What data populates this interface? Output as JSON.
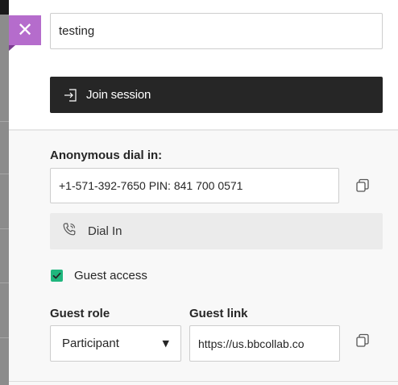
{
  "session": {
    "name_value": "testing",
    "join_label": "Join session"
  },
  "dial_in": {
    "label": "Anonymous dial in:",
    "number": "+1-571-392-7650 PIN: 841 700 0571",
    "button_label": "Dial In"
  },
  "guest": {
    "access_label": "Guest access",
    "access_checked": true,
    "role_label": "Guest role",
    "role_value": "Participant",
    "link_label": "Guest link",
    "link_value": "https://us.bbcollab.co"
  },
  "icons": {
    "close": "close-icon",
    "join": "enter-icon",
    "copy": "copy-icon",
    "phone": "phone-icon",
    "check": "checkmark-icon",
    "dropdown": "caret-down-icon"
  },
  "colors": {
    "accent": "#b56ccc",
    "join_button": "#262626",
    "checkbox": "#1fb67d",
    "dial_button": "#ebebeb"
  }
}
